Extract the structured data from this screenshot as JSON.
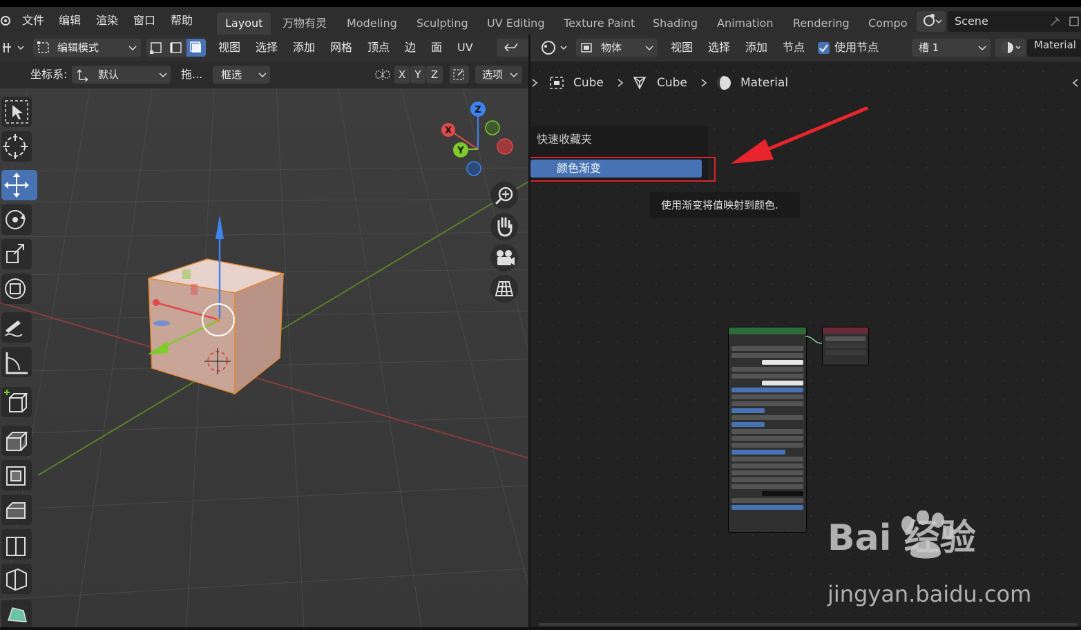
{
  "topbar": {
    "menus": [
      "文件",
      "编辑",
      "渲染",
      "窗口",
      "帮助"
    ],
    "workspaces": [
      "Layout",
      "万物有灵",
      "Modeling",
      "Sculpting",
      "UV Editing",
      "Texture Paint",
      "Shading",
      "Animation",
      "Rendering",
      "Compo"
    ],
    "active_workspace": "Layout",
    "scene_label": "Scene"
  },
  "viewport_header": {
    "mode": "编辑模式",
    "menus": [
      "视图",
      "选择",
      "添加",
      "网格",
      "顶点",
      "边",
      "面",
      "UV"
    ],
    "coord_label": "坐标系:",
    "coord_value": "默认",
    "drag_label": "拖...",
    "select_mode": "框选",
    "axes": [
      "X",
      "Y",
      "Z"
    ],
    "options_label": "选项"
  },
  "gizmo": {
    "z": "Z",
    "x": "X",
    "y": "Y"
  },
  "node_header": {
    "object_label": "物体",
    "menus": [
      "视图",
      "选择",
      "添加",
      "节点"
    ],
    "use_nodes_label": "使用节点",
    "use_nodes_checked": true,
    "slot_label": "槽 1",
    "material_label": "Material"
  },
  "breadcrumb": [
    "Cube",
    "Cube",
    "Material"
  ],
  "popup": {
    "header": "快速收藏夹",
    "item": "颜色渐变",
    "tooltip": "使用渐变将值映射到颜色."
  },
  "watermark": {
    "brand": "Bai  经验",
    "url": "jingyan.baidu.com"
  },
  "colors": {
    "accent": "#4772b3",
    "highlight_box": "#e0202a",
    "arrow": "#e8242c"
  }
}
